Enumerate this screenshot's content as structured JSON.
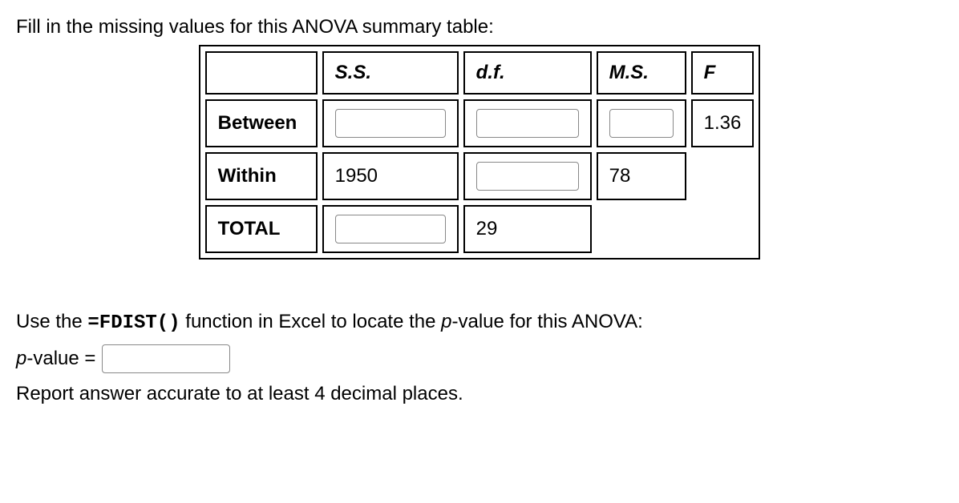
{
  "questionPrompt": "Fill in the missing values for this ANOVA summary table:",
  "table": {
    "headers": {
      "ss": "S.S.",
      "df": "d.f.",
      "ms": "M.S.",
      "f": "F"
    },
    "rows": {
      "between": {
        "label": "Between",
        "f": "1.36"
      },
      "within": {
        "label": "Within",
        "ss": "1950",
        "ms": "78"
      },
      "total": {
        "label": "TOTAL",
        "df": "29"
      }
    }
  },
  "instruction": {
    "prefix": "Use the ",
    "fn": "=FDIST()",
    "suffix": " function in Excel to locate the ",
    "pvalueWord": "p",
    "suffix2": "-value for this ANOVA:"
  },
  "pvalueLabel": {
    "p": "p",
    "rest": "-value ="
  },
  "accuracyNote": "Report answer accurate to at least 4 decimal places."
}
